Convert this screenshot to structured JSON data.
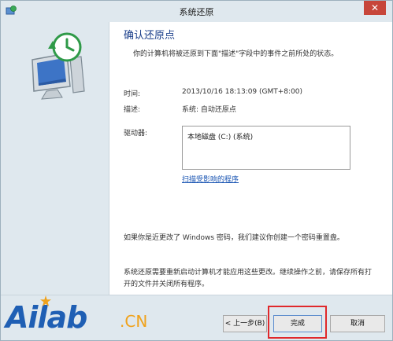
{
  "window": {
    "title": "系统还原",
    "close_label": "✕"
  },
  "content": {
    "heading": "确认还原点",
    "description": "你的计算机将被还原到下面\"描述\"字段中的事件之前所处的状态。",
    "time_label": "时间:",
    "time_value": "2013/10/16 18:13:09 (GMT+8:00)",
    "desc_label": "描述:",
    "desc_value": "系统: 自动还原点",
    "drives_label": "驱动器:",
    "drives": [
      "本地磁盘 (C:) (系统)"
    ],
    "scan_link": "扫描受影响的程序",
    "password_note": "如果你是近更改了 Windows 密码，我们建议你创建一个密码重置盘。",
    "restart_note": "系统还原需要重新启动计算机才能应用这些更改。继续操作之前，请保存所有打开的文件并关闭所有程序。"
  },
  "buttons": {
    "back": "< 上一步(B)",
    "finish": "完成",
    "cancel": "取消"
  },
  "watermark": {
    "main": "Ailab",
    "suffix": ".CN"
  },
  "colors": {
    "heading": "#1a3e8a",
    "link": "#1a55b3",
    "highlight": "#e0282b",
    "logo_blue": "#1f5fb4",
    "logo_orange": "#f0a21b"
  }
}
